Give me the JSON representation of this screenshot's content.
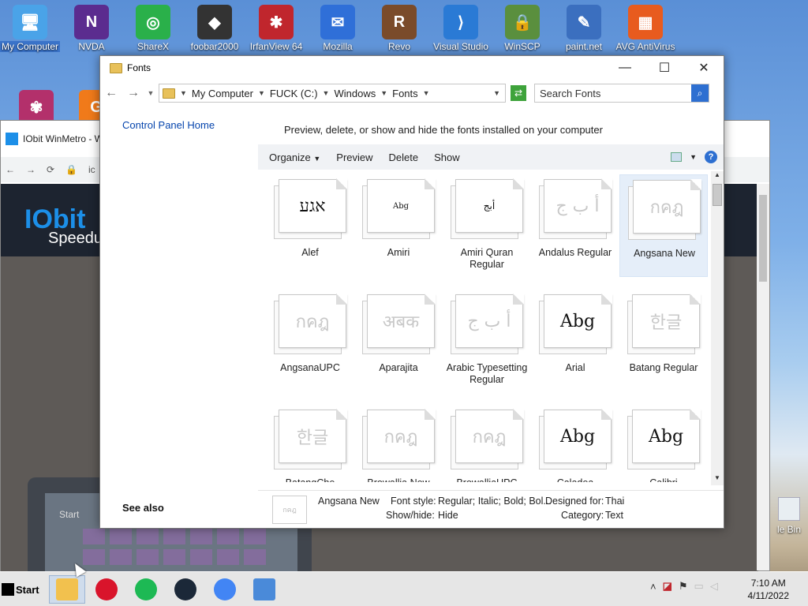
{
  "desktop": {
    "icons": [
      {
        "label": "My Computer",
        "color": "#4aa3e8",
        "glyph": "🖥"
      },
      {
        "label": "NVDA",
        "color": "#5b2c8f",
        "glyph": "N"
      },
      {
        "label": "ShareX",
        "color": "#2ab04a",
        "glyph": "◎"
      },
      {
        "label": "foobar2000",
        "color": "#333333",
        "glyph": "◆"
      },
      {
        "label": "IrfanView 64",
        "color": "#c0262d",
        "glyph": "✱"
      },
      {
        "label": "Mozilla",
        "color": "#2f6fd8",
        "glyph": "✉"
      },
      {
        "label": "Revo",
        "color": "#7a4b2a",
        "glyph": "R"
      },
      {
        "label": "Visual Studio",
        "color": "#2a7ad5",
        "glyph": "⟩"
      },
      {
        "label": "WinSCP",
        "color": "#5a8f3e",
        "glyph": "🔒"
      },
      {
        "label": "paint.net",
        "color": "#3b6fbf",
        "glyph": "✎"
      },
      {
        "label": "AVG AntiVirus",
        "color": "#e85b1e",
        "glyph": "▦"
      }
    ],
    "recycle_label": "le Bin"
  },
  "bg_browser": {
    "tab_title": "IObit WinMetro - W",
    "address": "ic",
    "brand": "IObit",
    "brand2": "Speedup",
    "start_label": "Start"
  },
  "fonts_window": {
    "title": "Fonts",
    "breadcrumb": [
      "My Computer",
      "FUCK (C:)",
      "Windows",
      "Fonts"
    ],
    "search_placeholder": "Search Fonts",
    "control_panel_home": "Control Panel Home",
    "see_also": "See also",
    "description": "Preview, delete, or show and hide the fonts installed on your computer",
    "commands": {
      "organize": "Organize",
      "preview": "Preview",
      "delete": "Delete",
      "show": "Show"
    },
    "fonts": [
      {
        "name": "Alef",
        "sample": "אגע",
        "faded": false
      },
      {
        "name": "Amiri",
        "sample": "Abg",
        "faded": false
      },
      {
        "name": "Amiri Quran Regular",
        "sample": "أبج",
        "faded": false
      },
      {
        "name": "Andalus Regular",
        "sample": "أ ب ج",
        "faded": true
      },
      {
        "name": "Angsana New",
        "sample": "กคฎ",
        "faded": true
      },
      {
        "name": "AngsanaUPC",
        "sample": "กคฎ",
        "faded": true
      },
      {
        "name": "Aparajita",
        "sample": "अबक",
        "faded": true
      },
      {
        "name": "Arabic Typesetting Regular",
        "sample": "أ ب ج",
        "faded": true
      },
      {
        "name": "Arial",
        "sample": "Abg",
        "faded": false
      },
      {
        "name": "Batang Regular",
        "sample": "한글",
        "faded": true
      },
      {
        "name": "BatangChe",
        "sample": "한글",
        "faded": true
      },
      {
        "name": "Browallia New",
        "sample": "กคฎ",
        "faded": true
      },
      {
        "name": "BrowalliaUPC",
        "sample": "กคฎ",
        "faded": true
      },
      {
        "name": "Caladea",
        "sample": "Abg",
        "faded": false
      },
      {
        "name": "Calibri",
        "sample": "Abg",
        "faded": false
      }
    ],
    "selected_font": "Angsana New",
    "details": {
      "name": "Angsana New",
      "font_style_label": "Font style:",
      "font_style": "Regular; Italic; Bold; Bol...",
      "designed_for_label": "Designed for:",
      "designed_for": "Thai",
      "show_hide_label": "Show/hide:",
      "show_hide": "Hide",
      "category_label": "Category:",
      "category": "Text",
      "thumb": "กคฎ"
    }
  },
  "taskbar": {
    "start_label": "Start",
    "apps": [
      {
        "name": "file-explorer",
        "color": "#f2c14e"
      },
      {
        "name": "opera",
        "color": "#d9142b"
      },
      {
        "name": "spotify",
        "color": "#1db954"
      },
      {
        "name": "steam",
        "color": "#1b2838"
      },
      {
        "name": "chrome",
        "color": "#4285f4"
      },
      {
        "name": "installer",
        "color": "#4a8ad9"
      }
    ],
    "time": "7:10 AM",
    "date": "4/11/2022"
  }
}
